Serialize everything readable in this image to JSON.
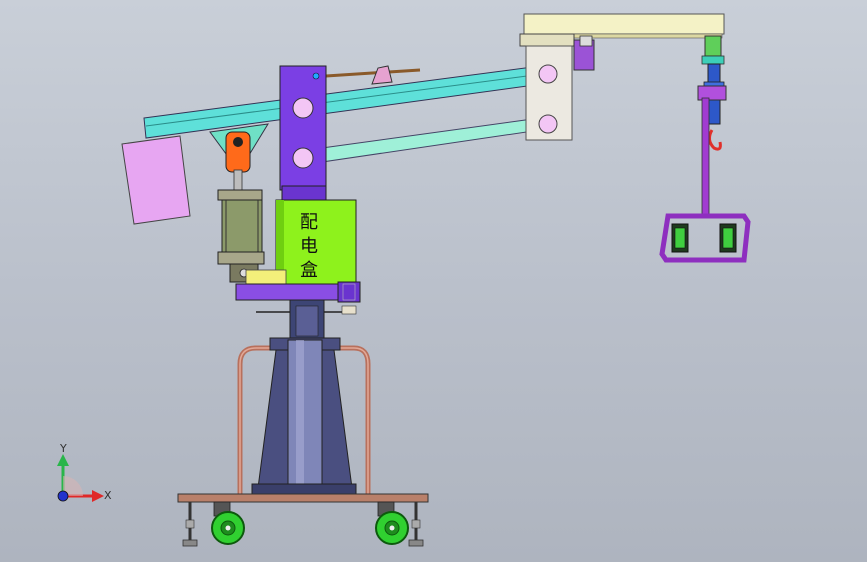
{
  "viewport": {
    "name": "cad-model-view",
    "background_top": "#c9cfd8",
    "background_bottom": "#aeb4bf"
  },
  "model": {
    "control_box_label": [
      "配",
      "电",
      "盒"
    ],
    "colors": {
      "column_upper": "#7b3fe4",
      "column_hole": "#f3c6f5",
      "control_box": "#8ef21c",
      "arm_main": "#5ee0d9",
      "arm_lower": "#9ff0d8",
      "counterweight": "#e7a6f2",
      "end_block": "#ece9e1",
      "top_beam": "#f4f2c6",
      "rod_magenta": "#a13bd1",
      "wheel": "#30d030",
      "base_plate": "#b9806a",
      "pedestal": "#4a4f80",
      "handrail": "#b8705c",
      "cylinder": "#8c9a6a",
      "orange_part": "#ff6a1a"
    }
  },
  "triad": {
    "y_label": "Y",
    "x_label": "X",
    "y_color": "#29b54a",
    "x_color": "#e02828",
    "origin_color": "#2233cc"
  }
}
